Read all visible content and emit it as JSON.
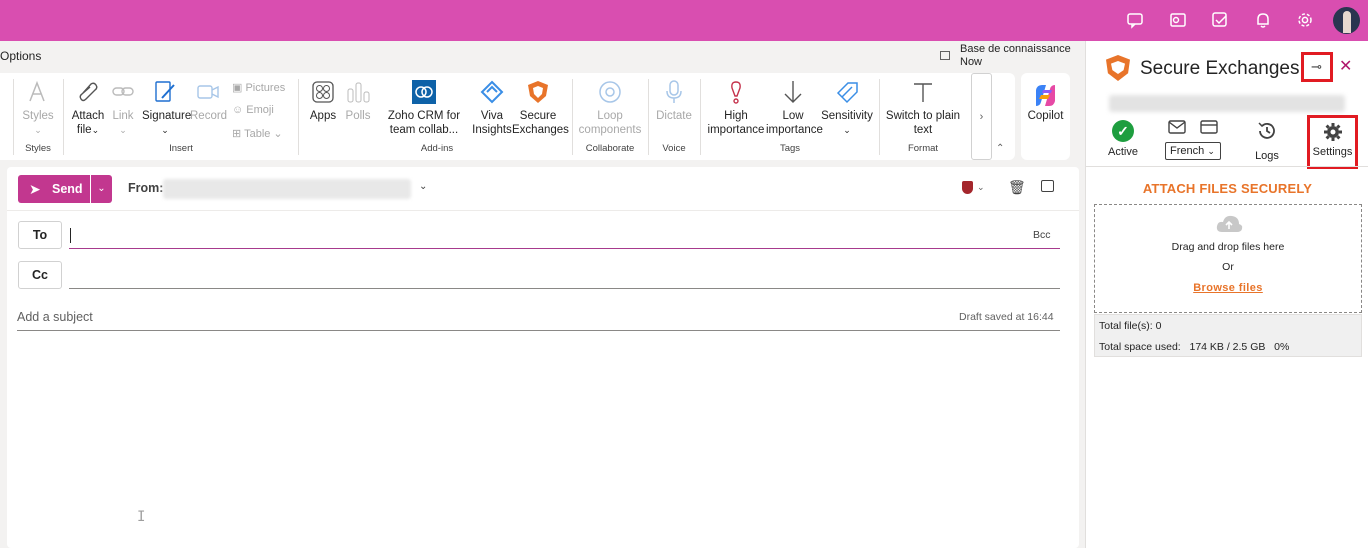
{
  "topbar": {
    "icons": [
      "feedback-icon",
      "outlook-icon",
      "tasks-icon",
      "bell-icon",
      "settings-icon"
    ],
    "bg_color": "#d94eb0"
  },
  "options_bar": {
    "label": "Options",
    "knowledge_base": "Base de connaissance",
    "knowledge_base_time": "Now"
  },
  "ribbon": {
    "styles": "Styles",
    "styles_group": "Styles",
    "attach": "Attach file",
    "link": "Link",
    "signature": "Signature",
    "record": "Record",
    "pictures": "Pictures",
    "emoji": "Emoji",
    "table": "Table",
    "insert_group": "Insert",
    "apps": "Apps",
    "polls": "Polls",
    "zoho": "Zoho CRM for team collab...",
    "viva": "Viva Insights",
    "secure": "Secure Exchanges",
    "addins_group": "Add-ins",
    "loop": "Loop components",
    "collaborate_group": "Collaborate",
    "dictate": "Dictate",
    "voice_group": "Voice",
    "high": "High importance",
    "low": "Low importance",
    "sensitivity": "Sensitivity",
    "tags_group": "Tags",
    "plain": "Switch to plain text",
    "format_group": "Format",
    "copilot": "Copilot"
  },
  "compose": {
    "send": "Send",
    "from_label": "From:",
    "to": "To",
    "cc": "Cc",
    "bcc": "Bcc",
    "subject_placeholder": "Add a subject",
    "draft_status": "Draft saved at 16:44"
  },
  "panel": {
    "title": "Secure Exchanges",
    "active": "Active",
    "language": "French",
    "logs": "Logs",
    "settings": "Settings",
    "attach_title": "ATTACH FILES SECURELY",
    "drop_text": "Drag and drop files here",
    "or_text": "Or",
    "browse": "Browse files",
    "total_files": "Total file(s): 0",
    "total_space_label": "Total space used:",
    "total_space_value": "174 KB / 2.5 GB",
    "total_space_pct": "0%",
    "accent_color": "#e8742a",
    "highlight_color": "#e11b22"
  }
}
